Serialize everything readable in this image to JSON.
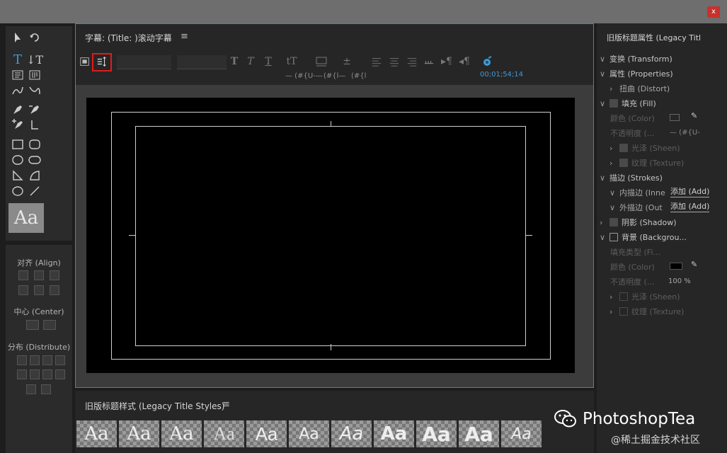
{
  "window": {
    "close_label": "x"
  },
  "aa_swatch": "Aa",
  "align_panel": {
    "align_label": "对齐 (Align)",
    "center_label": "中心 (Center)",
    "distribute_label": "分布 (Distribute)"
  },
  "title_panel": {
    "title": "字幕: (Title: )滚动字幕",
    "menu": "≡",
    "val1": "— (#{U-—",
    "val2": "(#{l—",
    "val3": "(#{l",
    "timecode": "00;01;54;14"
  },
  "properties": {
    "title": "旧版标题属性 (Legacy Titl",
    "transform": "变换 (Transform)",
    "props": "属性 (Properties)",
    "distort": "扭曲 (Distort)",
    "fill": "填充 (Fill)",
    "color": "颜色 (Color)",
    "opacity": "不透明度 (...",
    "opacity_val": "— (#{U-",
    "sheen": "光泽 (Sheen)",
    "texture": "纹理 (Texture)",
    "strokes": "描边 (Strokes)",
    "inner": "内描边 (Inne",
    "outer": "外描边 (Out",
    "add1": "添加 (Add)",
    "add2": "添加 (Add)",
    "shadow": "阴影 (Shadow)",
    "background": "背景 (Backgrou...",
    "fill_type": "填充类型 (Fi...",
    "bg_color": "颜色 (Color)",
    "bg_opacity": "不透明度 (...",
    "bg_opacity_val": "100 %",
    "bg_sheen": "光泽 (Sheen)",
    "bg_texture": "纹理 (Texture)"
  },
  "styles_panel": {
    "title": "旧版标题样式 (Legacy Title Styles)",
    "menu": "≡",
    "tiles": [
      "Aa",
      "Aa",
      "Aa",
      "Aa",
      "Aa",
      "Aa",
      "Aa",
      "Aa",
      "Aa",
      "Aa",
      "Aa"
    ]
  },
  "watermark": {
    "brand": "PhotoshopTea",
    "site": "@稀土掘金技术社区"
  }
}
